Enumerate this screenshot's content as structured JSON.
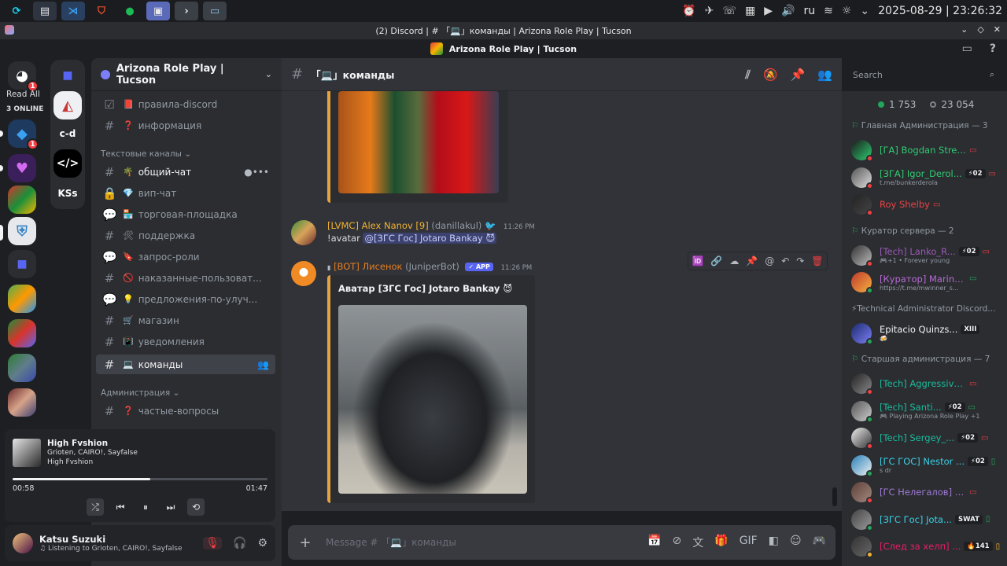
{
  "os_bar": {
    "apps": [
      "C",
      "≡",
      "VS",
      "B",
      "S",
      "◆",
      ">",
      "□"
    ],
    "locale": "ru",
    "datetime": "2025-08-29 | 23:26:32"
  },
  "window": {
    "title": "(2) Discord | # 「💻」команды | Arizona Role Play | Tucson"
  },
  "discord_title": "Arizona Role Play | Tucson",
  "servers": {
    "read_all_label": "Read All",
    "online_label": "3 ONLINE",
    "home_badge": "1",
    "items": [
      {
        "label": "c-d"
      },
      {
        "label": "KSs"
      }
    ],
    "badge2": "1"
  },
  "guild": {
    "name": "Arizona Role Play | Tucson"
  },
  "channels": {
    "top": [
      {
        "icon": "📕",
        "name": "правила-discord",
        "kind": "rules"
      },
      {
        "icon": "❓",
        "name": "информация",
        "kind": "text"
      }
    ],
    "category_text": "Текстовые каналы",
    "text": [
      {
        "icon": "🌴",
        "name": "общий-чат",
        "kind": "text",
        "bright": true
      },
      {
        "icon": "💎",
        "name": "вип-чат",
        "kind": "locked"
      },
      {
        "icon": "🏪",
        "name": "торговая-площадка",
        "kind": "forum"
      },
      {
        "icon": "🛠",
        "name": "поддержка",
        "kind": "text"
      },
      {
        "icon": "🔖",
        "name": "запрос-роли",
        "kind": "forum"
      },
      {
        "icon": "🚫",
        "name": "наказанные-пользоват...",
        "kind": "text"
      },
      {
        "icon": "💡",
        "name": "предложения-по-улуч...",
        "kind": "forum"
      },
      {
        "icon": "🛒",
        "name": "магазин",
        "kind": "text"
      },
      {
        "icon": "📳",
        "name": "уведомления",
        "kind": "text"
      },
      {
        "icon": "💻",
        "name": "команды",
        "kind": "text",
        "active": true
      }
    ],
    "category_admin": "Администрация",
    "admin": [
      {
        "icon": "❓",
        "name": "частые-вопросы",
        "kind": "text"
      }
    ]
  },
  "player": {
    "track": "High Fvshion",
    "artists": "Grioten, CAIRO!, Sayfalse",
    "album": "High Fvshion",
    "elapsed": "00:58",
    "duration": "01:47",
    "progress": 0.54
  },
  "user": {
    "name": "Katsu Suzuki",
    "status": "Listening to Grioten, CAIRO!, Sayfalse"
  },
  "chat": {
    "channel_name": "「💻」команды",
    "search_placeholder": "Search",
    "messages": [
      {
        "author": "[LVMC] Alex Nanov [9]",
        "username": "(danillakul)",
        "time": "11:26 PM",
        "text": "!avatar",
        "mention": "@[ЗГС Гос] Jotaro Bankay 😈"
      },
      {
        "author": "[BOT] Лисенок",
        "username": "(JuniperBot)",
        "app_tag": "APP",
        "time": "11:26 PM",
        "embed_title": "Аватар [ЗГС Гос] Jotaro Bankay 😈"
      }
    ],
    "input_placeholder": "Message # 「💻」команды"
  },
  "members": {
    "online_count": "1 753",
    "total_count": "23 054",
    "groups": [
      {
        "title": "Главная Администрация — 3",
        "members": [
          {
            "name": "[ГА] Bogdan Strelkov",
            "color": "#2ecc71",
            "status": "dnd",
            "device": "desktop"
          },
          {
            "name": "[ЗГА] Igor_Derol...",
            "sub": "t.me/bunkerderola",
            "tag": "⚡02",
            "color": "#2ecc71",
            "status": "dnd",
            "device": "desktop"
          },
          {
            "name": "Roy Shelby",
            "color": "#ed4245",
            "status": "dnd",
            "device": "desktop"
          }
        ]
      },
      {
        "title": "Куратор сервера — 2",
        "members": [
          {
            "name": "[Tech] Lanko_R...",
            "sub": "🎮+1 • Forever young",
            "tag": "⚡02",
            "color": "#9b59b6",
            "status": "dnd",
            "device": "desktop"
          },
          {
            "name": "[Куратор] Marina_...",
            "sub": "https://t.me/mwinner_s...",
            "color": "#b86ad6",
            "status": "online",
            "device": "desktop"
          }
        ]
      },
      {
        "title": "⚡Technical Administrator Discord...",
        "members": [
          {
            "name": "Epitacio Quinzs...",
            "sub": "🍻",
            "tag": "XIII",
            "color": "#f2f3f5",
            "status": "online",
            "device": ""
          }
        ]
      },
      {
        "title": "Старшая администрация — 7",
        "members": [
          {
            "name": "[Tech] Aggressive ...",
            "color": "#1abc9c",
            "status": "dnd",
            "device": "desktop"
          },
          {
            "name": "[Tech] Santi...",
            "sub": "🎮 Playing Arizona Role Play +1",
            "tag": "⚡02",
            "color": "#1abc9c",
            "status": "online",
            "device": "desktop"
          },
          {
            "name": "[Tech] Sergey_...",
            "tag": "⚡02",
            "color": "#1abc9c",
            "status": "dnd",
            "device": "desktop"
          },
          {
            "name": "[ГС ГОС] Nestor ...",
            "sub": "s dr",
            "tag": "⚡02",
            "color": "#3ad1e6",
            "status": "online",
            "device": "mobile"
          },
          {
            "name": "[ГС Нелегалов] Jake_...",
            "color": "#a07ad6",
            "status": "dnd",
            "device": "desktop"
          },
          {
            "name": "[ЗГС Гос] Jota...",
            "tag": "SWAT",
            "color": "#3ad1e6",
            "status": "online",
            "device": "mobile"
          },
          {
            "name": "[След за хелп] ...",
            "tag": "🔥141",
            "color": "#e91e63",
            "status": "idle",
            "device": "mobile"
          }
        ]
      }
    ]
  },
  "colors": {
    "accent": "#5865f2",
    "online": "#23a55a",
    "dnd": "#f23f43",
    "idle": "#f0b232"
  }
}
